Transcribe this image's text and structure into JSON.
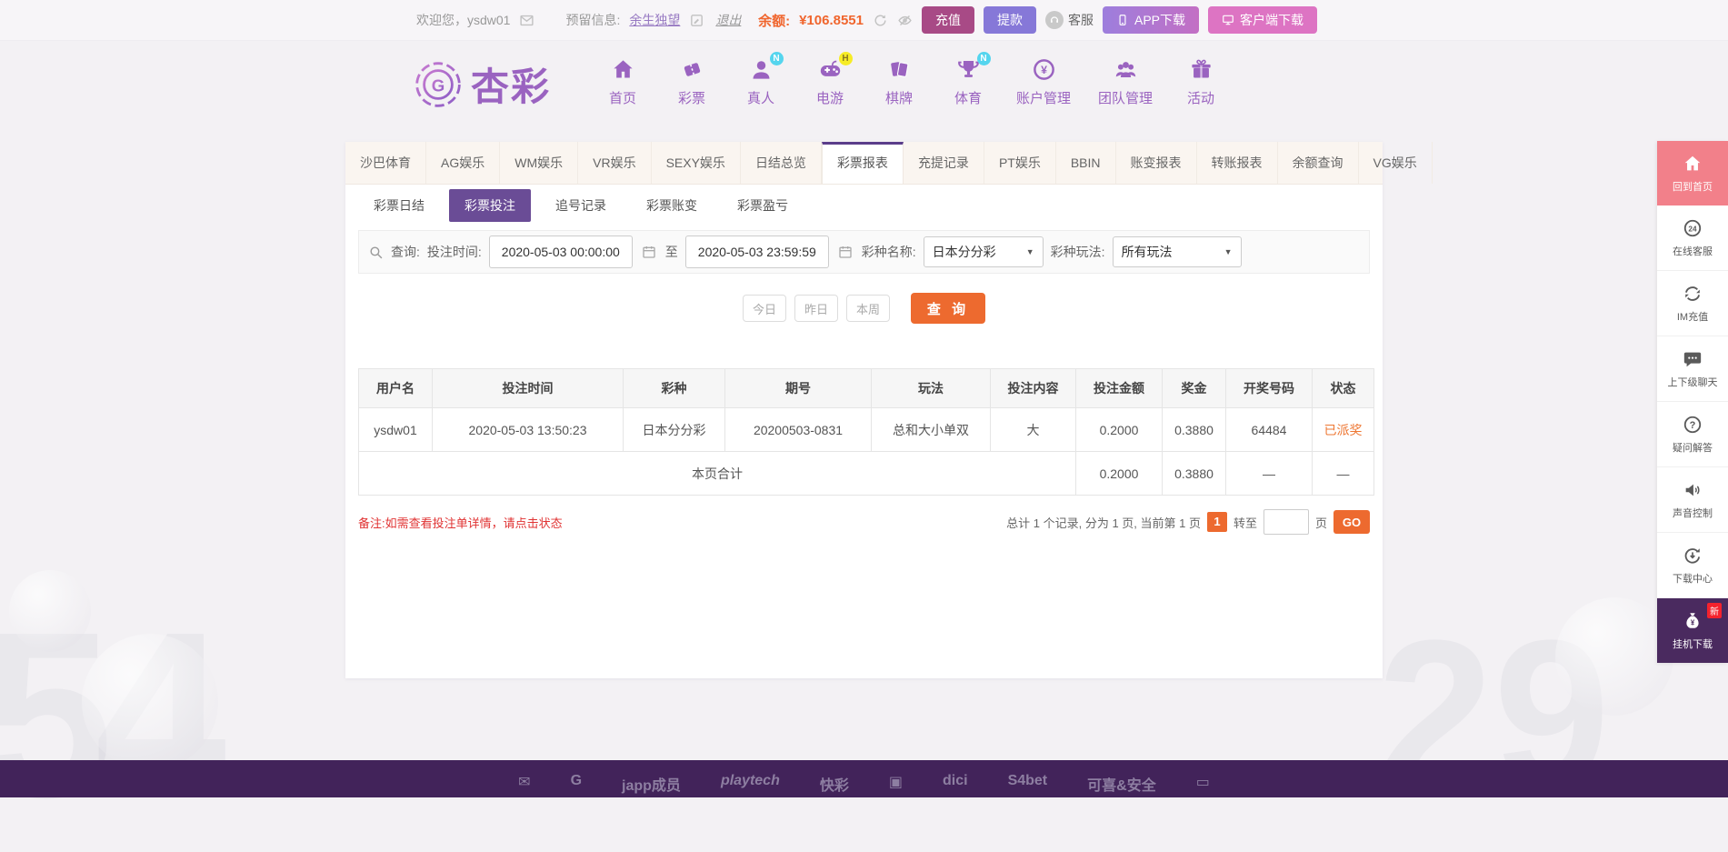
{
  "topbar": {
    "welcome": "欢迎您，ysdw01",
    "reserved_label": "预留信息:",
    "reserved_value": "余生独望",
    "logout": "退出",
    "balance_label": "余额:",
    "balance_value": "¥106.8551",
    "recharge_label": "充值",
    "withdraw_label": "提款",
    "service_label": "客服",
    "app_download_label": "APP下载",
    "client_download_label": "客户端下载"
  },
  "header": {
    "logo_text": "杏彩",
    "nav": [
      {
        "label": "首页",
        "icon": "home-icon",
        "badge": ""
      },
      {
        "label": "彩票",
        "icon": "ticket-icon",
        "badge": ""
      },
      {
        "label": "真人",
        "icon": "live-person-icon",
        "badge": "N"
      },
      {
        "label": "电游",
        "icon": "gamepad-icon",
        "badge": "H"
      },
      {
        "label": "棋牌",
        "icon": "cards-icon",
        "badge": ""
      },
      {
        "label": "体育",
        "icon": "trophy-icon",
        "badge": "N"
      },
      {
        "label": "账户管理",
        "icon": "coin-icon",
        "badge": ""
      },
      {
        "label": "团队管理",
        "icon": "team-icon",
        "badge": ""
      },
      {
        "label": "活动",
        "icon": "gift-icon",
        "badge": ""
      }
    ]
  },
  "tabs": {
    "items": [
      "沙巴体育",
      "AG娱乐",
      "WM娱乐",
      "VR娱乐",
      "SEXY娱乐",
      "日结总览",
      "彩票报表",
      "充提记录",
      "PT娱乐",
      "BBIN",
      "账变报表",
      "转账报表",
      "余额查询",
      "VG娱乐"
    ],
    "active": "彩票报表"
  },
  "subtabs": {
    "items": [
      "彩票日结",
      "彩票投注",
      "追号记录",
      "彩票账变",
      "彩票盈亏"
    ],
    "active": "彩票投注"
  },
  "query": {
    "search_label": "查询:",
    "time_label": "投注时间:",
    "time_from": "2020-05-03 00:00:00",
    "to_label": "至",
    "time_to": "2020-05-03 23:59:59",
    "lottery_label": "彩种名称:",
    "lottery_value": "日本分分彩",
    "play_label": "彩种玩法:",
    "play_value": "所有玩法",
    "btn_today": "今日",
    "btn_yesterday": "昨日",
    "btn_week": "本周",
    "btn_query": "查 询"
  },
  "table": {
    "headers": [
      "用户名",
      "投注时间",
      "彩种",
      "期号",
      "玩法",
      "投注内容",
      "投注金额",
      "奖金",
      "开奖号码",
      "状态"
    ],
    "rows": [
      [
        "ysdw01",
        "2020-05-03 13:50:23",
        "日本分分彩",
        "20200503-0831",
        "总和大小单双",
        "大",
        "0.2000",
        "0.3880",
        "64484",
        "已派奖"
      ]
    ],
    "total_label": "本页合计",
    "total": [
      "0.2000",
      "0.3880",
      "—",
      "—"
    ]
  },
  "note": "备注:如需查看投注单详情，请点击状态",
  "pagination": {
    "summary": "总计 1 个记录, 分为 1 页, 当前第 1 页",
    "current_page": "1",
    "goto_label": "转至",
    "page_unit": "页",
    "go_label": "GO"
  },
  "sidebar": {
    "items": [
      {
        "label": "回到首页",
        "icon": "back-home-icon",
        "badge": ""
      },
      {
        "label": "在线客服",
        "icon": "service-24-icon",
        "badge": ""
      },
      {
        "label": "IM充值",
        "icon": "im-recharge-icon",
        "badge": ""
      },
      {
        "label": "上下级聊天",
        "icon": "chat-icon",
        "badge": ""
      },
      {
        "label": "疑问解答",
        "icon": "question-icon",
        "badge": ""
      },
      {
        "label": "声音控制",
        "icon": "sound-icon",
        "badge": ""
      },
      {
        "label": "下载中心",
        "icon": "download-icon",
        "badge": ""
      },
      {
        "label": "挂机下载",
        "icon": "moneybag-icon",
        "badge": "新"
      }
    ]
  },
  "footer": {
    "logos": [
      {
        "name": "mail-logo",
        "text": "✉"
      },
      {
        "name": "g-logo",
        "text": "G"
      },
      {
        "name": "japp-logo",
        "text": "japp成员"
      },
      {
        "name": "playtech-logo",
        "text": "playtech"
      },
      {
        "name": "kuaicai-logo",
        "text": "快彩"
      },
      {
        "name": "logo-box",
        "text": "▣"
      },
      {
        "name": "dici-logo",
        "text": "dici"
      },
      {
        "name": "sbet-logo",
        "text": "S4bet"
      },
      {
        "name": "security-logo",
        "text": "可喜&安全"
      },
      {
        "name": "logo-box2",
        "text": "▭"
      }
    ]
  },
  "watermarks": {
    "left": "54",
    "right": "29"
  },
  "colors": {
    "accent_orange": "#ed6a2f",
    "brand_purple": "#9a63c0",
    "active_tab_purple": "#5b3d8a",
    "active_subtab_purple": "#6a4c96",
    "status_orange": "#ee7733",
    "recharge_magenta": "#a84a86",
    "withdraw_purple": "#8678d8",
    "client_pink": "#dd74c3",
    "sidebar_top_pink": "#f2808a",
    "sidebar_bottom_purple": "#4a2a5f",
    "footer_purple": "#42235a"
  }
}
